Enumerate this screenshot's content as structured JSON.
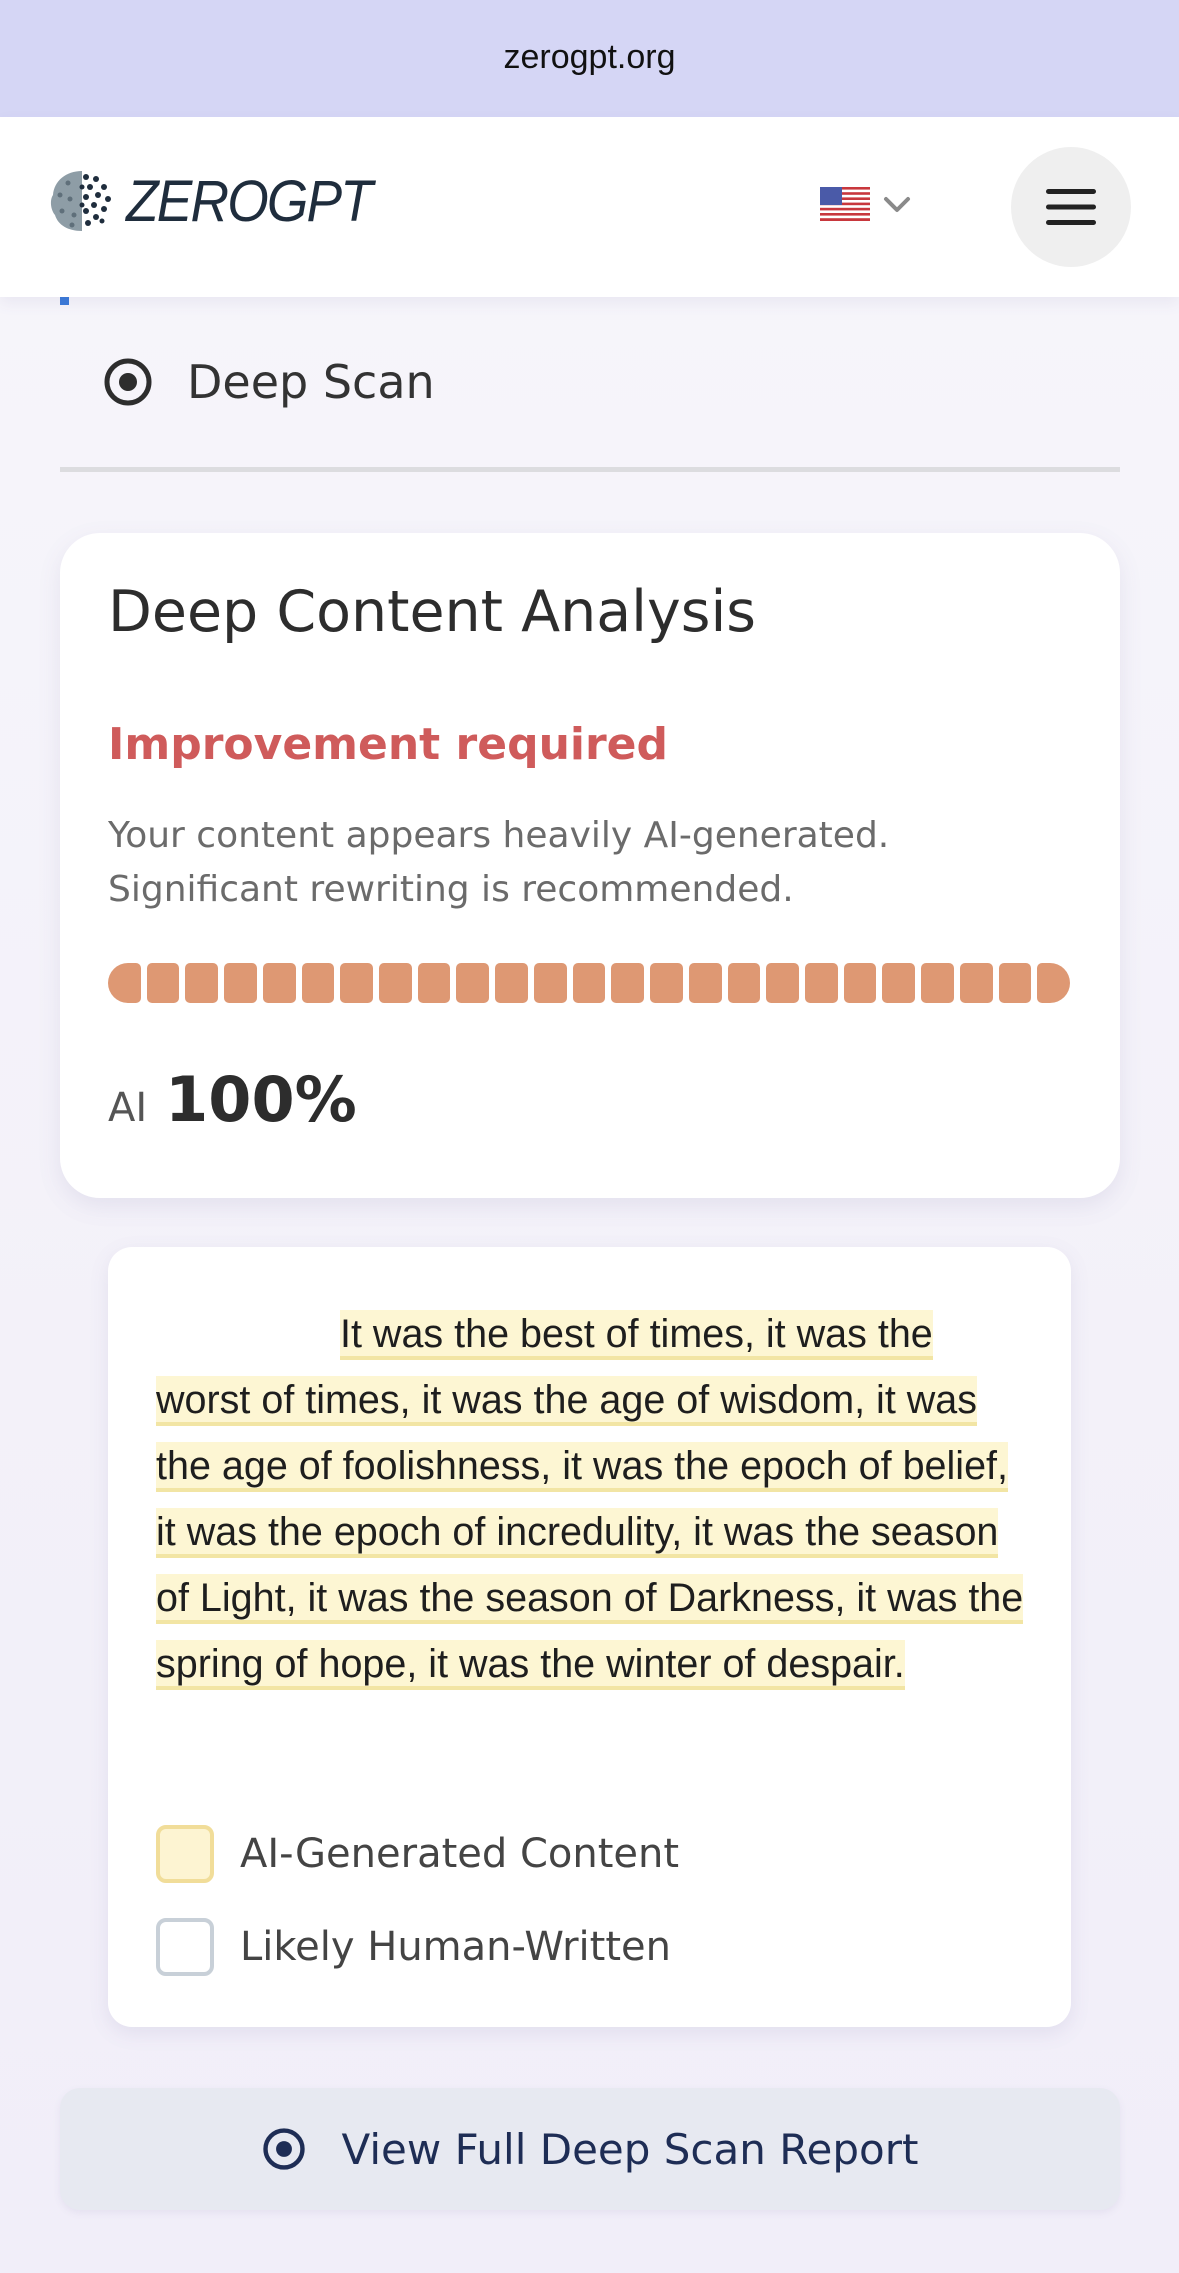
{
  "browser": {
    "url": "zerogpt.org"
  },
  "header": {
    "logo_text": "ZEROGPT",
    "icons": {
      "logo": "brain-logo-icon",
      "language": "us-flag-icon",
      "dropdown": "chevron-down-icon",
      "menu": "hamburger-menu-icon"
    }
  },
  "tab": {
    "label": "Deep Scan",
    "icon": "target-icon"
  },
  "analysis": {
    "title": "Deep Content Analysis",
    "status": "Improvement required",
    "description": "Your content appears heavily AI-generated. Significant rewriting is recommended.",
    "meter_fraction": 1.0,
    "meter_segments": 25,
    "score_label": "AI",
    "score_value": "100%"
  },
  "result": {
    "passage": "It was the best of times, it was the worst of times, it was the age of wisdom, it was the age of foolishness, it was the epoch of belief, it was the epoch of incredulity, it was the season of Light, it was the season of Darkness, it was the spring of hope, it was the winter of despair.",
    "legend": {
      "ai_label": "AI-Generated Content",
      "human_label": "Likely Human-Written"
    }
  },
  "report_button": {
    "label": "View Full Deep Scan Report",
    "icon": "target-icon"
  },
  "colors": {
    "url_bar": "#d5d6f5",
    "status_red": "#cf5b5b",
    "meter_fill": "#de9873",
    "highlight": "#fdf6d3",
    "button_bg": "#e7e9f1",
    "button_text": "#1e2d55"
  }
}
